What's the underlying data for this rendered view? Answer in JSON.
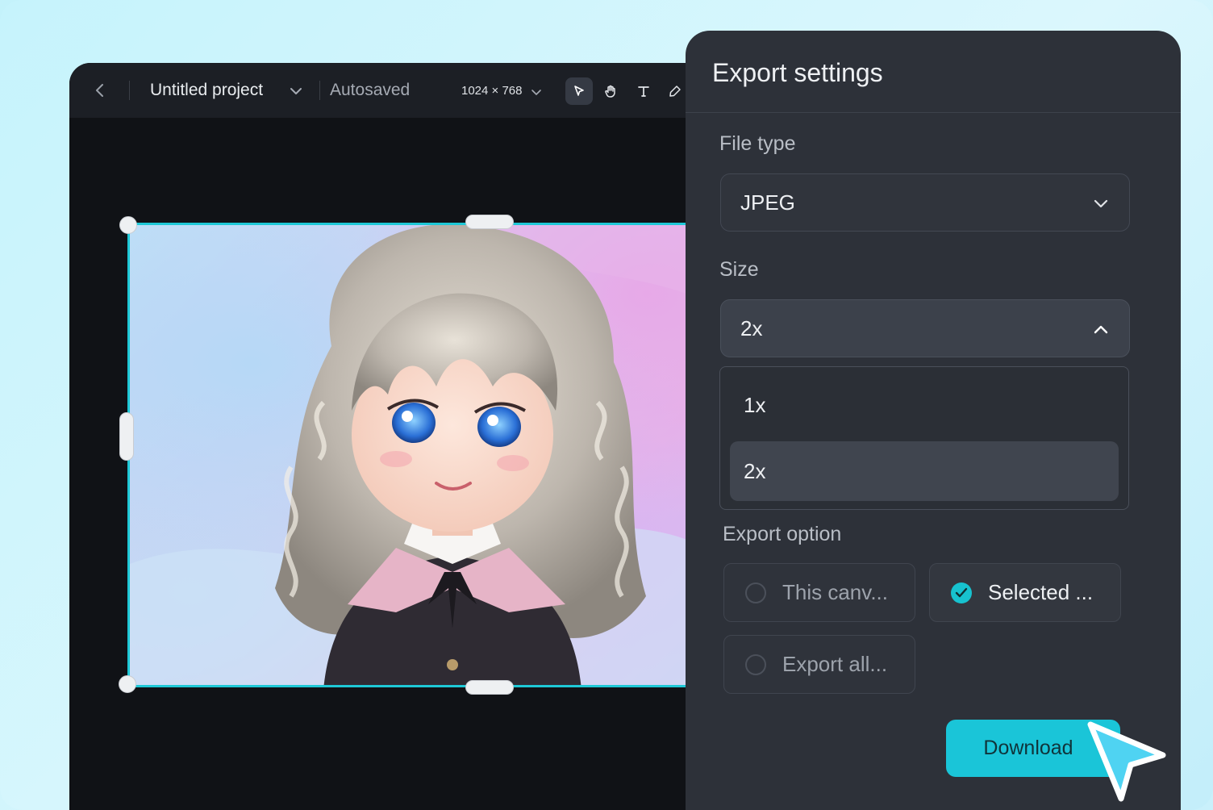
{
  "editor": {
    "back_icon": "chevron-left-icon",
    "project_name": "Untitled project",
    "save_status": "Autosaved",
    "canvas_size": "1024 × 768",
    "tools": [
      "select-icon",
      "hand-icon",
      "text-icon",
      "pen-icon"
    ],
    "accent": "#1ec8d6"
  },
  "export": {
    "title": "Export settings",
    "file_type_label": "File type",
    "file_type_value": "JPEG",
    "size_label": "Size",
    "size_value": "2x",
    "size_options": [
      "1x",
      "2x"
    ],
    "export_option_label": "Export option",
    "options": [
      {
        "label": "This canv...",
        "checked": false
      },
      {
        "label": "Selected ...",
        "checked": true
      },
      {
        "label": "Export all...",
        "checked": false
      }
    ],
    "download_label": "Download",
    "accent": "#1ac5d8"
  }
}
